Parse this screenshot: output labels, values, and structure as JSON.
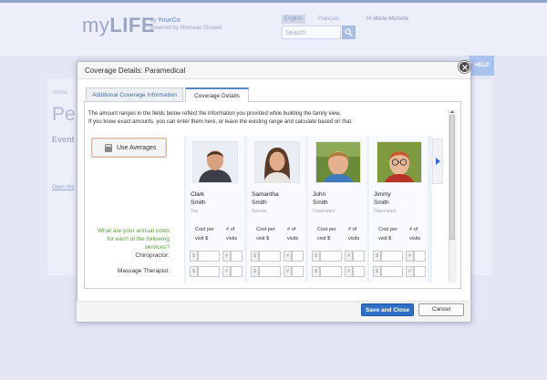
{
  "background": {
    "logo_light": "my",
    "logo_bold": "LIFE",
    "by_label": "by",
    "brand": "YourCo",
    "powered_by": "powered by Morneau Shepell",
    "lang_english": "English",
    "lang_french": "Français",
    "user_name": "Hi Marie-Michelle",
    "search_placeholder": "Search",
    "help_label": "HELP",
    "crumb": "Home",
    "page_title_partial": "Pers",
    "event_partial": "Event T",
    "link_partial": "Open Mo"
  },
  "modal": {
    "title": "Coverage Details: Paramedical",
    "tabs": [
      {
        "label": "Additional Coverage Information",
        "active": false
      },
      {
        "label": "Coverage Details",
        "active": true
      }
    ],
    "intro_line1": "The amount ranges in the fields below reflect the information you provided while building the family view.",
    "intro_line2": "If you know exact amounts, you can enter them here, or leave the existing range and calculate based on that.",
    "use_averages_label": "Use Averages",
    "question": "What are your annual costs for each of the following services?",
    "services": [
      "Chiropractor:",
      "Massage Therapist:"
    ],
    "col_cost": "Cost per visit $",
    "col_visits": "# of visits",
    "members": [
      {
        "first": "Clark",
        "last": "Smith",
        "role": "You",
        "photo": "man-photo"
      },
      {
        "first": "Samantha",
        "last": "Smith",
        "role": "Spouse",
        "photo": "woman-photo"
      },
      {
        "first": "John",
        "last": "Smith",
        "role": "Dependant",
        "photo": "boy-photo"
      },
      {
        "first": "Jimmy",
        "last": "Smith",
        "role": "Dependant",
        "photo": "boy-glasses-photo"
      }
    ],
    "dollar_prefix": "$",
    "hash_prefix": "#",
    "save_label": "Save and Close",
    "cancel_label": "Cancel"
  },
  "colors": {
    "accent": "#2f6fc6",
    "question_green": "#55a03b",
    "tab_link": "#3a6fa8"
  }
}
